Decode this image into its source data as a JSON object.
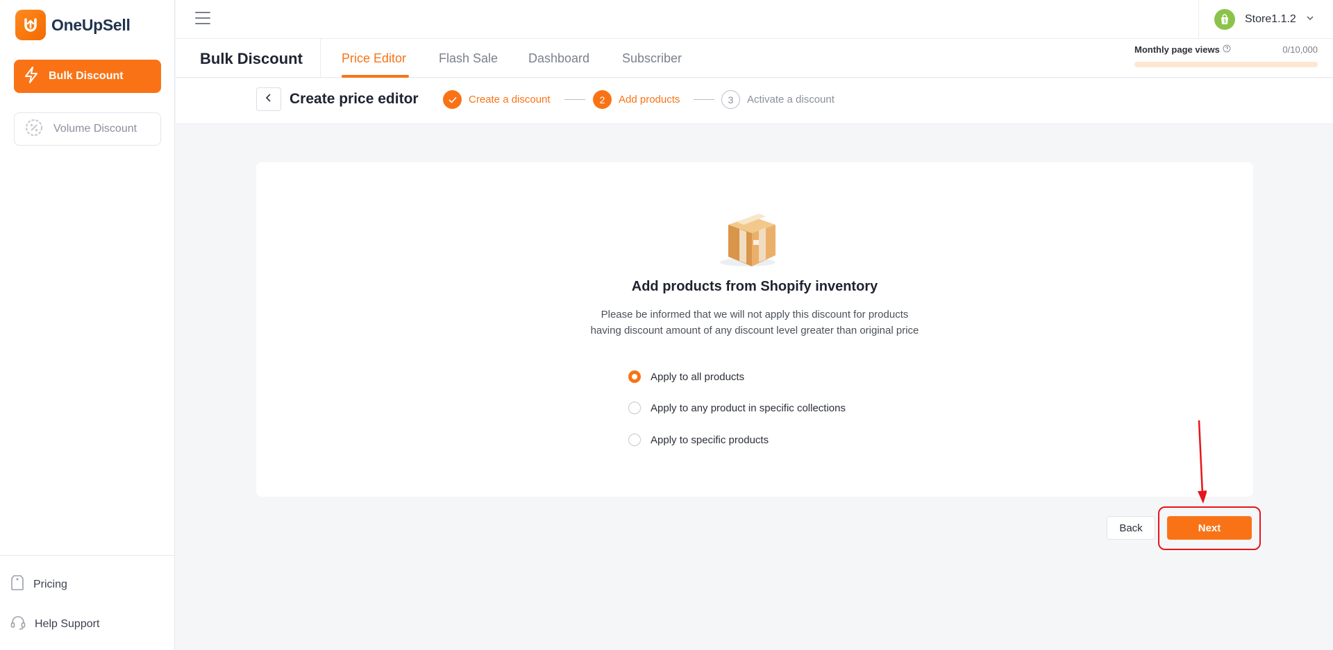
{
  "brand": {
    "name": "OneUpSell"
  },
  "sidebar": {
    "primary_label": "Bulk Discount",
    "secondary_label": "Volume Discount",
    "links": [
      {
        "label": "Pricing"
      },
      {
        "label": "Help Support"
      }
    ]
  },
  "topbar": {
    "store_name": "Store1.1.2"
  },
  "nav": {
    "title": "Bulk Discount",
    "tabs": [
      {
        "label": "Price Editor",
        "active": true
      },
      {
        "label": "Flash Sale",
        "active": false
      },
      {
        "label": "Dashboard",
        "active": false
      },
      {
        "label": "Subscriber",
        "active": false
      }
    ],
    "views": {
      "label": "Monthly page views",
      "value": "0/10,000",
      "progress": 0
    }
  },
  "steps": {
    "page_title": "Create price editor",
    "items": [
      {
        "number": "1",
        "label": "Create a discount",
        "state": "done"
      },
      {
        "number": "2",
        "label": "Add products",
        "state": "current"
      },
      {
        "number": "3",
        "label": "Activate a discount",
        "state": "todo"
      }
    ]
  },
  "card": {
    "title": "Add products from Shopify inventory",
    "desc_line1": "Please be informed that we will not apply this discount for products",
    "desc_line2": "having discount amount of any discount level greater than original price",
    "options": [
      {
        "label": "Apply to all products",
        "checked": true
      },
      {
        "label": "Apply to any product in specific collections",
        "checked": false
      },
      {
        "label": "Apply to specific products",
        "checked": false
      }
    ]
  },
  "actions": {
    "back_label": "Back",
    "next_label": "Next"
  },
  "colors": {
    "accent": "#f97316",
    "annotation": "#e8141b",
    "store_badge": "#8bc34a"
  }
}
